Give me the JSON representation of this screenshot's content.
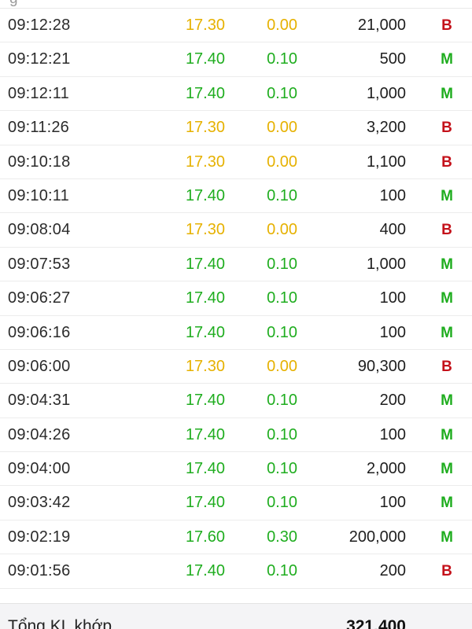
{
  "colors": {
    "up": "#1fad1f",
    "reference": "#e6b100",
    "buy": "#1fad1f",
    "sell": "#c4111a",
    "text": "#2b2b2b",
    "footer_background": "#f4f4f6"
  },
  "trades": [
    {
      "time": "09:12:28",
      "price": "17.30",
      "change": "0.00",
      "volume": "21,000",
      "side": "B",
      "tone": "ref"
    },
    {
      "time": "09:12:21",
      "price": "17.40",
      "change": "0.10",
      "volume": "500",
      "side": "M",
      "tone": "up"
    },
    {
      "time": "09:12:11",
      "price": "17.40",
      "change": "0.10",
      "volume": "1,000",
      "side": "M",
      "tone": "up"
    },
    {
      "time": "09:11:26",
      "price": "17.30",
      "change": "0.00",
      "volume": "3,200",
      "side": "B",
      "tone": "ref"
    },
    {
      "time": "09:10:18",
      "price": "17.30",
      "change": "0.00",
      "volume": "1,100",
      "side": "B",
      "tone": "ref"
    },
    {
      "time": "09:10:11",
      "price": "17.40",
      "change": "0.10",
      "volume": "100",
      "side": "M",
      "tone": "up"
    },
    {
      "time": "09:08:04",
      "price": "17.30",
      "change": "0.00",
      "volume": "400",
      "side": "B",
      "tone": "ref"
    },
    {
      "time": "09:07:53",
      "price": "17.40",
      "change": "0.10",
      "volume": "1,000",
      "side": "M",
      "tone": "up"
    },
    {
      "time": "09:06:27",
      "price": "17.40",
      "change": "0.10",
      "volume": "100",
      "side": "M",
      "tone": "up"
    },
    {
      "time": "09:06:16",
      "price": "17.40",
      "change": "0.10",
      "volume": "100",
      "side": "M",
      "tone": "up"
    },
    {
      "time": "09:06:00",
      "price": "17.30",
      "change": "0.00",
      "volume": "90,300",
      "side": "B",
      "tone": "ref"
    },
    {
      "time": "09:04:31",
      "price": "17.40",
      "change": "0.10",
      "volume": "200",
      "side": "M",
      "tone": "up"
    },
    {
      "time": "09:04:26",
      "price": "17.40",
      "change": "0.10",
      "volume": "100",
      "side": "M",
      "tone": "up"
    },
    {
      "time": "09:04:00",
      "price": "17.40",
      "change": "0.10",
      "volume": "2,000",
      "side": "M",
      "tone": "up"
    },
    {
      "time": "09:03:42",
      "price": "17.40",
      "change": "0.10",
      "volume": "100",
      "side": "M",
      "tone": "up"
    },
    {
      "time": "09:02:19",
      "price": "17.60",
      "change": "0.30",
      "volume": "200,000",
      "side": "M",
      "tone": "up"
    },
    {
      "time": "09:01:56",
      "price": "17.40",
      "change": "0.10",
      "volume": "200",
      "side": "B",
      "tone": "up"
    }
  ],
  "footer": {
    "label": "Tổng KL khớp",
    "total": "321,400"
  }
}
